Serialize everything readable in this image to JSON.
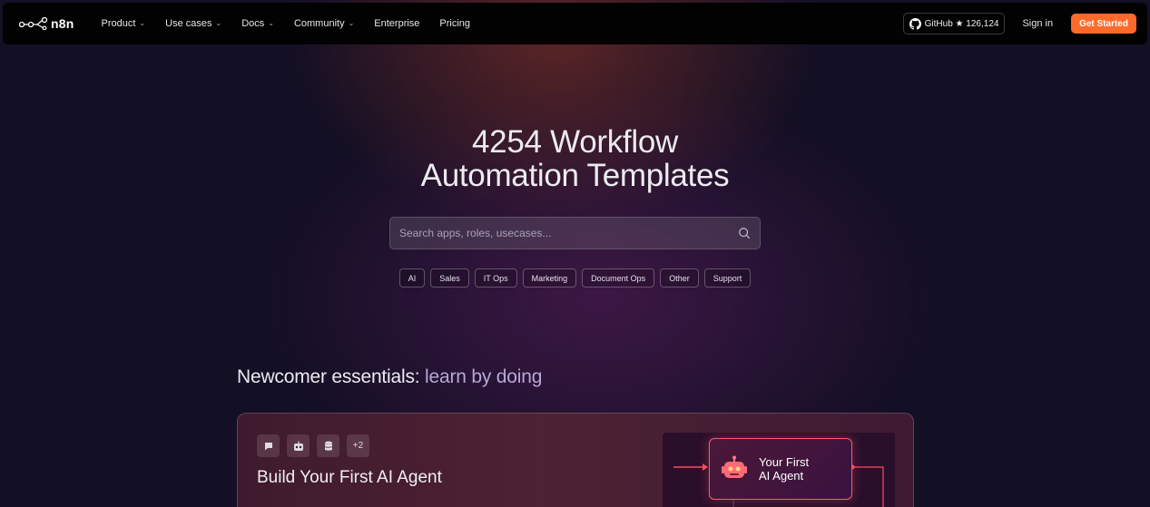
{
  "nav": {
    "logo_text": "n8n",
    "menu": [
      {
        "label": "Product",
        "dropdown": true
      },
      {
        "label": "Use cases",
        "dropdown": true
      },
      {
        "label": "Docs",
        "dropdown": true
      },
      {
        "label": "Community",
        "dropdown": true
      },
      {
        "label": "Enterprise",
        "dropdown": false
      },
      {
        "label": "Pricing",
        "dropdown": false
      }
    ],
    "github_label": "GitHub ★ 126,124",
    "signin_label": "Sign in",
    "get_started_label": "Get Started"
  },
  "hero": {
    "title_line1": "4254 Workflow",
    "title_line2": "Automation Templates",
    "search_placeholder": "Search apps, roles, usecases..."
  },
  "chips": [
    "AI",
    "Sales",
    "IT Ops",
    "Marketing",
    "Document Ops",
    "Other",
    "Support"
  ],
  "section": {
    "title_main": "Newcomer essentials: ",
    "title_accent": "learn by doing"
  },
  "card": {
    "badge_more": "+2",
    "title": "Build Your First AI Agent",
    "preview_line1": "Your First",
    "preview_line2": "AI Agent"
  },
  "colors": {
    "accent_orange": "#ff6a2a",
    "node_border": "#ff5a6e",
    "background": "#130f24"
  }
}
